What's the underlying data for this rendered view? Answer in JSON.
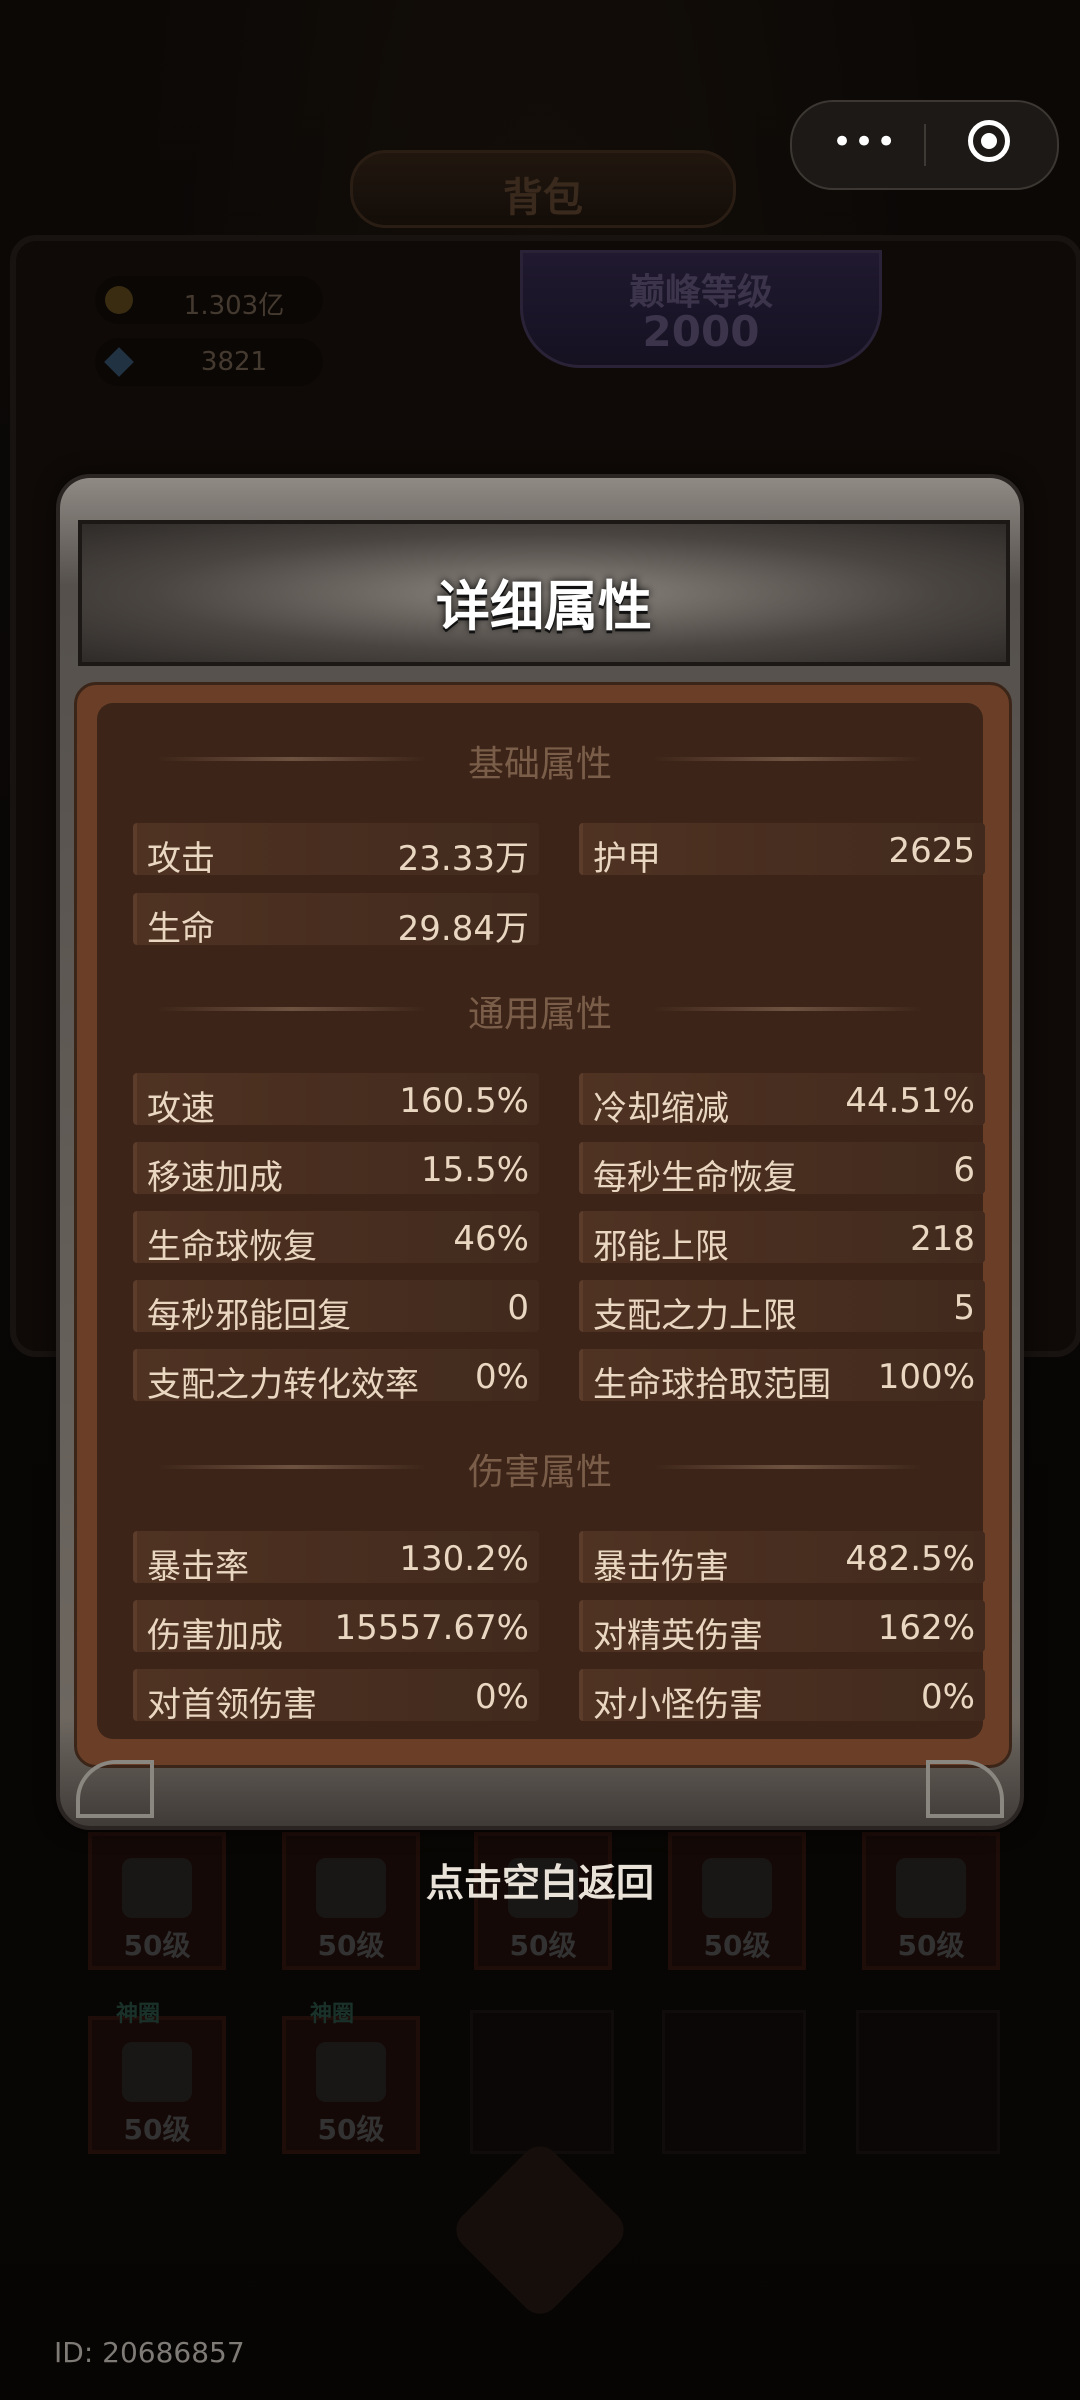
{
  "background": {
    "bag_title": "背包",
    "currency": [
      {
        "icon": "coin-icon",
        "value": "1.303亿"
      },
      {
        "icon": "gem-icon",
        "value": "3821"
      }
    ],
    "peak_label": "巅峰等级",
    "peak_level": "2000",
    "slot_tag": "神圈",
    "slot_level": "50级"
  },
  "capsule": {
    "more_icon": "•••"
  },
  "dialog": {
    "title": "详细属性",
    "sections": {
      "basic": "基础属性",
      "general": "通用属性",
      "damage": "伤害属性"
    },
    "basic_stats": [
      {
        "name": "攻击",
        "value": "23.33万"
      },
      {
        "name": "护甲",
        "value": "2625"
      },
      {
        "name": "生命",
        "value": "29.84万"
      }
    ],
    "general_stats": [
      {
        "name": "攻速",
        "value": "160.5%"
      },
      {
        "name": "冷却缩减",
        "value": "44.51%"
      },
      {
        "name": "移速加成",
        "value": "15.5%"
      },
      {
        "name": "每秒生命恢复",
        "value": "6"
      },
      {
        "name": "生命球恢复",
        "value": "46%"
      },
      {
        "name": "邪能上限",
        "value": "218"
      },
      {
        "name": "每秒邪能回复",
        "value": "0"
      },
      {
        "name": "支配之力上限",
        "value": "5"
      },
      {
        "name": "支配之力转化效率",
        "value": "0%"
      },
      {
        "name": "生命球拾取范围",
        "value": "100%"
      }
    ],
    "damage_stats": [
      {
        "name": "暴击率",
        "value": "130.2%"
      },
      {
        "name": "暴击伤害",
        "value": "482.5%"
      },
      {
        "name": "伤害加成",
        "value": "15557.67%"
      },
      {
        "name": "对精英伤害",
        "value": "162%"
      },
      {
        "name": "对首领伤害",
        "value": "0%"
      },
      {
        "name": "对小怪伤害",
        "value": "0%"
      }
    ]
  },
  "return_hint": "点击空白返回",
  "id_label": "ID: 20686857"
}
